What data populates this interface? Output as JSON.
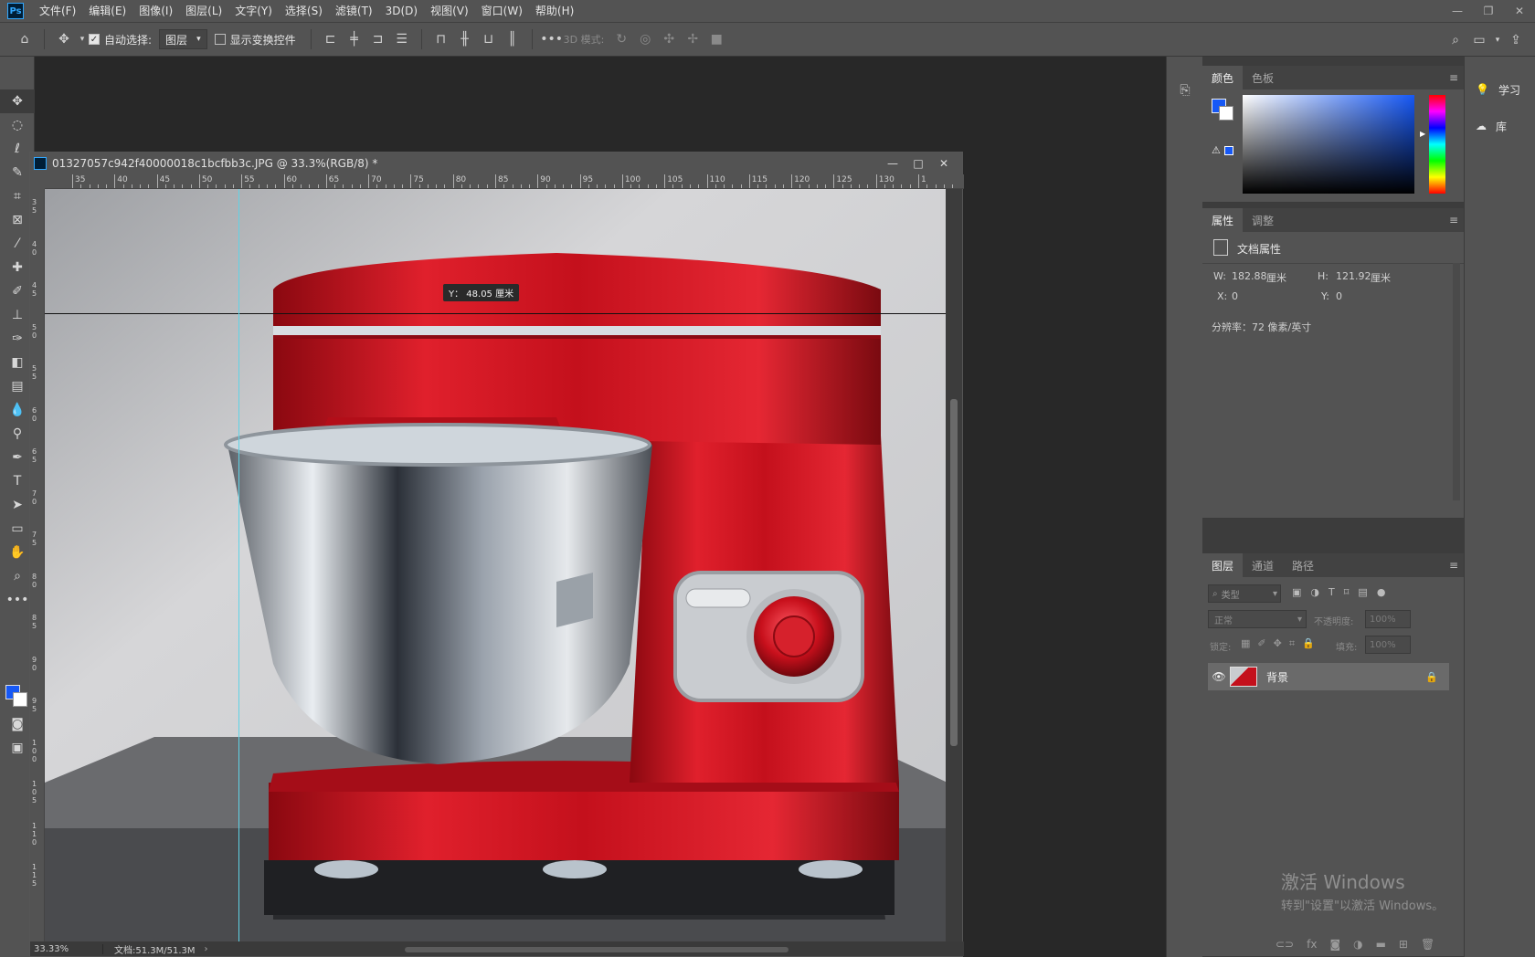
{
  "app": {
    "menu": [
      "文件(F)",
      "编辑(E)",
      "图像(I)",
      "图层(L)",
      "文字(Y)",
      "选择(S)",
      "滤镜(T)",
      "3D(D)",
      "视图(V)",
      "窗口(W)",
      "帮助(H)"
    ],
    "logo": "Ps"
  },
  "options": {
    "auto_select_label": "自动选择:",
    "auto_select_value": "图层",
    "show_transform_label": "显示变换控件",
    "mode_3d_label": "3D 模式:"
  },
  "document": {
    "title": "01327057c942f40000018c1bcfbb3c.JPG @ 33.3%(RGB/8) *",
    "ruler_top_labels": [
      "35",
      "40",
      "45",
      "50",
      "55",
      "60",
      "65",
      "70",
      "75",
      "80",
      "85",
      "90",
      "95",
      "100",
      "105",
      "110",
      "115",
      "120",
      "125",
      "130",
      "1"
    ],
    "ruler_left_labels": [
      "3 5",
      "4 0",
      "4 5",
      "5 0",
      "5 5",
      "6 0",
      "6 5",
      "7 0",
      "7 5",
      "8 0",
      "8 5",
      "9 0",
      "9 5",
      "1 0 0",
      "1 0 5",
      "1 1 0",
      "1 1 5"
    ],
    "measure_tooltip": "Y： 48.05 厘米",
    "status_zoom": "33.33%",
    "status_info": "文档:51.3M/51.3M"
  },
  "color_panel": {
    "tabs": [
      "颜色",
      "色板"
    ],
    "foreground": "#1658f5",
    "background": "#ffffff"
  },
  "properties_panel": {
    "tabs": [
      "属性",
      "调整"
    ],
    "section_title": "文档属性",
    "w_label": "W:",
    "w_value": "182.88",
    "w_unit": "厘米",
    "h_label": "H:",
    "h_value": "121.92",
    "h_unit": "厘米",
    "x_label": "X:",
    "x_value": "0",
    "y_label": "Y:",
    "y_value": "0",
    "resolution": "分辨率：72 像素/英寸"
  },
  "layers_panel": {
    "tabs": [
      "图层",
      "通道",
      "路径"
    ],
    "filter_placeholder": "类型",
    "blend_mode": "正常",
    "opacity_label": "不透明度:",
    "opacity_value": "100%",
    "lock_label": "锁定:",
    "fill_label": "填充:",
    "fill_value": "100%",
    "layers": [
      {
        "name": "背景"
      }
    ]
  },
  "learn_panel": {
    "learn": "学习",
    "library": "库"
  },
  "watermark": {
    "line1": "激活 Windows",
    "line2": "转到\"设置\"以激活 Windows。"
  }
}
